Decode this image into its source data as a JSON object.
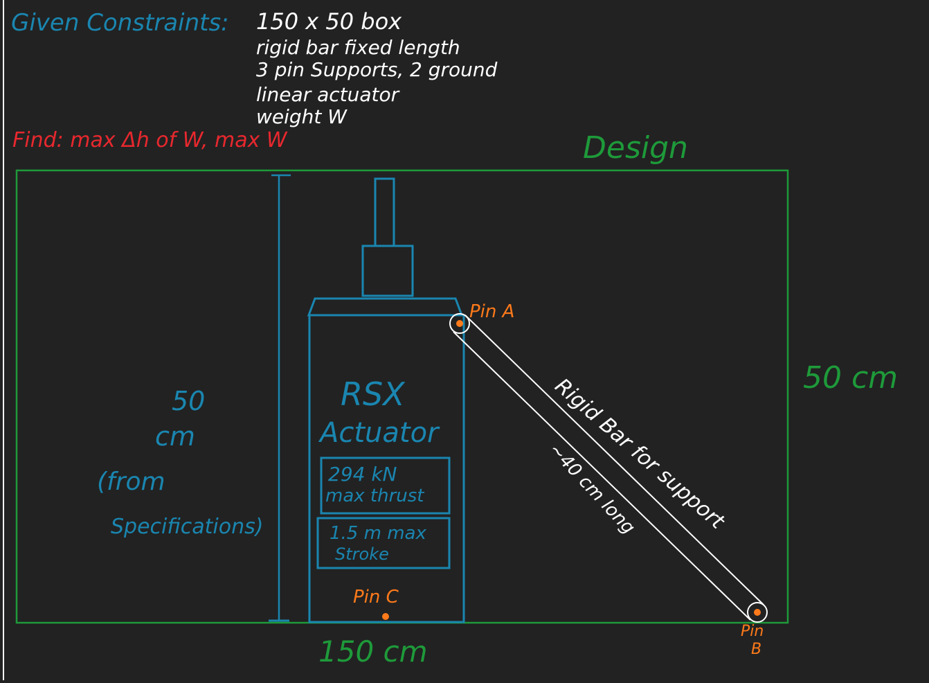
{
  "colors": {
    "background": "#222222",
    "blue": "#1a86b0",
    "green": "#1e9a3a",
    "red": "#e8282e",
    "orange": "#ff7a1a",
    "white": "#ffffff"
  },
  "header": {
    "given_label": "Given Constraints:",
    "constraints": [
      "150 x 50 box",
      "rigid bar fixed length",
      "3 pin Supports, 2 ground",
      "linear actuator",
      "weight W"
    ],
    "find_label": "Find: max Δh of W, max W"
  },
  "design": {
    "title": "Design",
    "width_label": "150 cm",
    "height_label": "50 cm",
    "dim_left_lines": [
      "50",
      "cm",
      "(from",
      "Specifications)"
    ]
  },
  "actuator": {
    "name_lines": [
      "RSX",
      "Actuator"
    ],
    "thrust_lines": [
      "294 kN",
      "max thrust"
    ],
    "stroke_lines": [
      "1.5 m max",
      "Stroke"
    ]
  },
  "pins": {
    "a": "Pin A",
    "b_lines": [
      "Pin",
      "B"
    ],
    "c": "Pin C"
  },
  "bar": {
    "label": "Rigid Bar for support",
    "length": "~40 cm long"
  }
}
